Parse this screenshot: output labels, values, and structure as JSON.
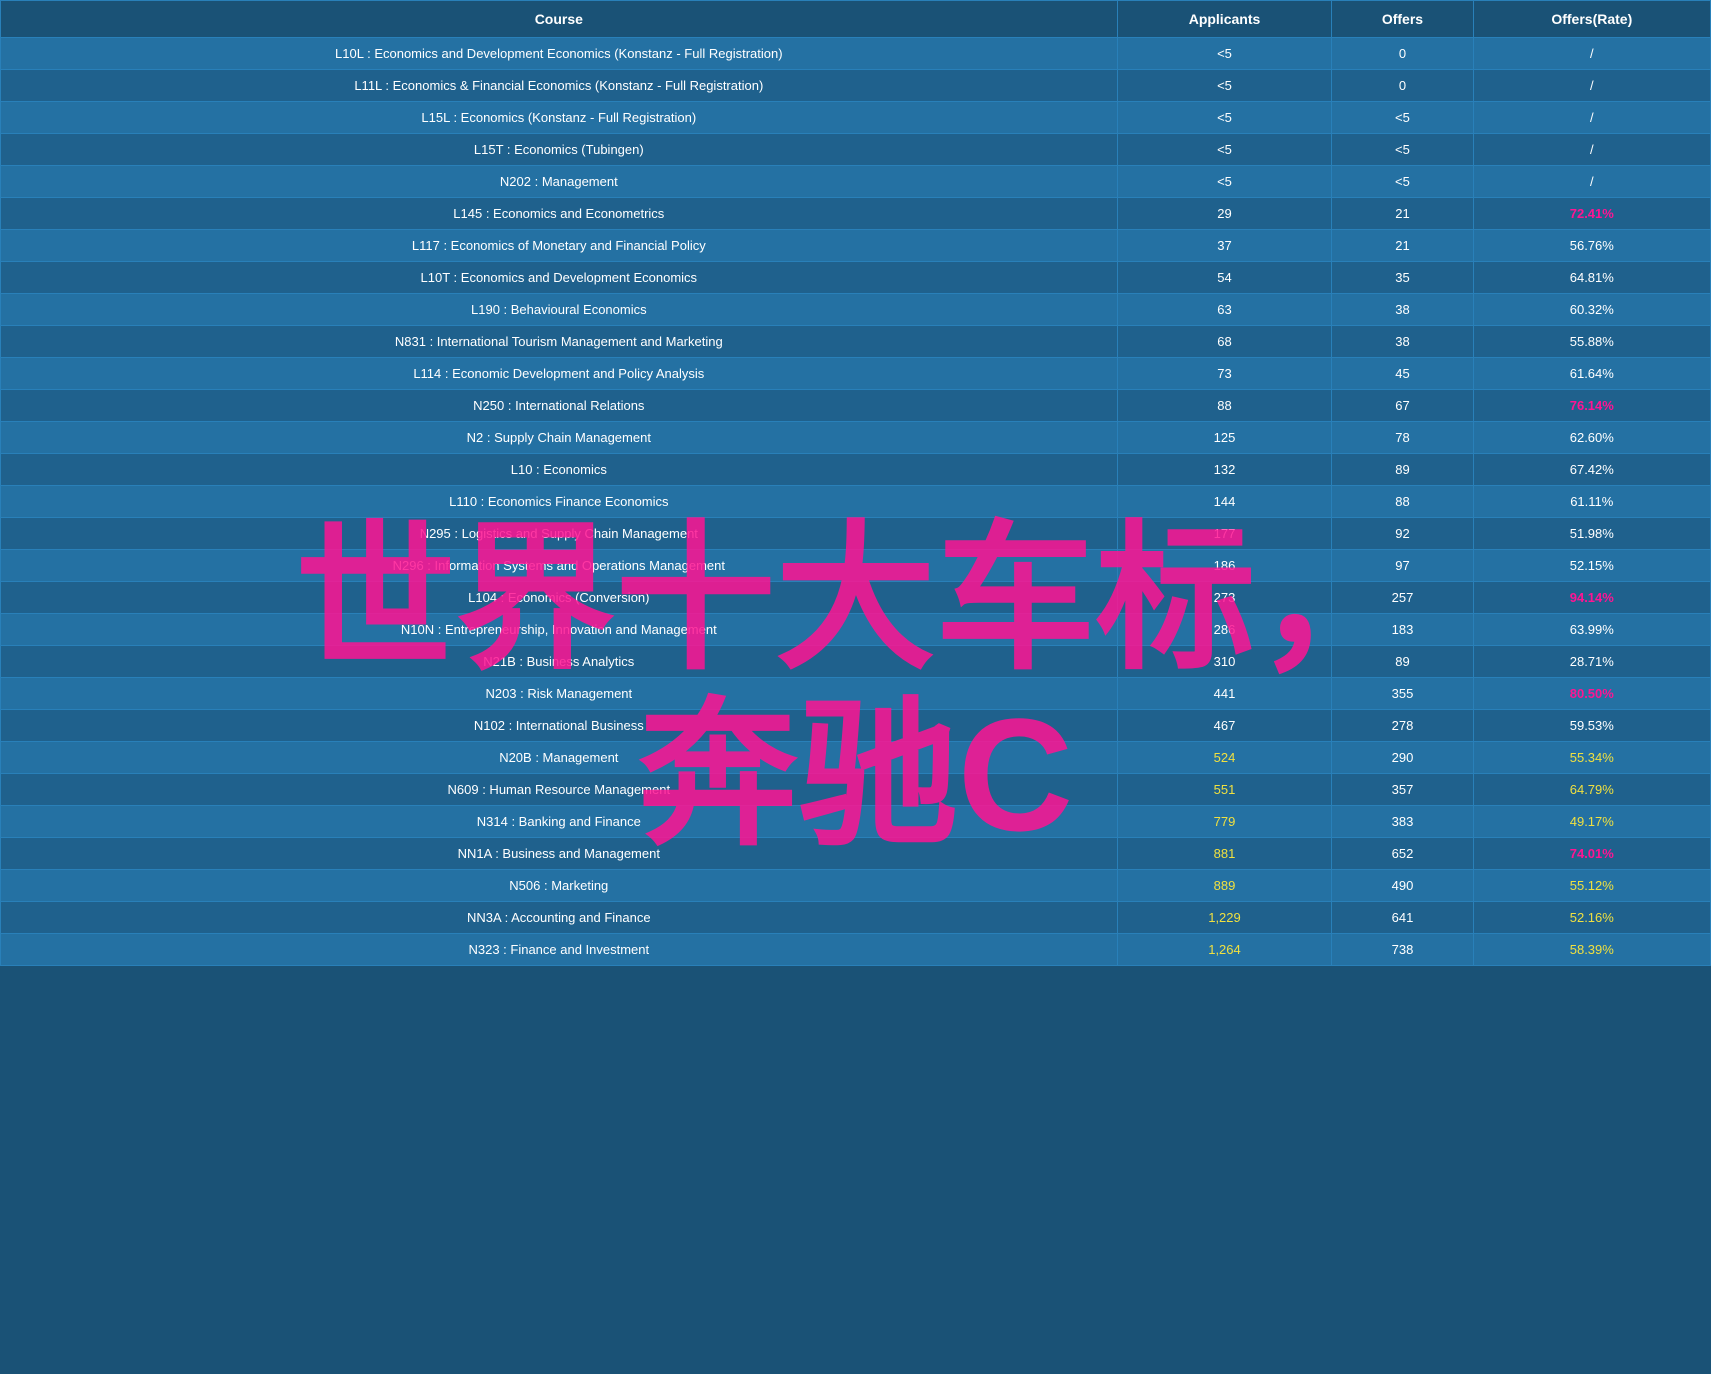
{
  "table": {
    "headers": [
      "Course",
      "Applicants",
      "Offers",
      "Offers(Rate)"
    ],
    "rows": [
      {
        "course": "L10L : Economics and Development Economics (Konstanz - Full Registration)",
        "applicants": "<5",
        "offers": "0",
        "rate": "/",
        "rateClass": ""
      },
      {
        "course": "L11L : Economics & Financial Economics (Konstanz - Full Registration)",
        "applicants": "<5",
        "offers": "0",
        "rate": "/",
        "rateClass": ""
      },
      {
        "course": "L15L : Economics (Konstanz - Full Registration)",
        "applicants": "<5",
        "offers": "<5",
        "rate": "/",
        "rateClass": ""
      },
      {
        "course": "L15T : Economics (Tubingen)",
        "applicants": "<5",
        "offers": "<5",
        "rate": "/",
        "rateClass": ""
      },
      {
        "course": "N202 : Management",
        "applicants": "<5",
        "offers": "<5",
        "rate": "/",
        "rateClass": ""
      },
      {
        "course": "L145 : Economics and Econometrics",
        "applicants": "29",
        "offers": "21",
        "rate": "72.41%",
        "rateClass": "highlight-red"
      },
      {
        "course": "L117 : Economics of Monetary and Financial Policy",
        "applicants": "37",
        "offers": "21",
        "rate": "56.76%",
        "rateClass": ""
      },
      {
        "course": "L10T : Economics and Development Economics",
        "applicants": "54",
        "offers": "35",
        "rate": "64.81%",
        "rateClass": ""
      },
      {
        "course": "L190 : Behavioural Economics",
        "applicants": "63",
        "offers": "38",
        "rate": "60.32%",
        "rateClass": ""
      },
      {
        "course": "N831 : International Tourism Management and Marketing",
        "applicants": "68",
        "offers": "38",
        "rate": "55.88%",
        "rateClass": ""
      },
      {
        "course": "L114 : Economic Development and Policy Analysis",
        "applicants": "73",
        "offers": "45",
        "rate": "61.64%",
        "rateClass": ""
      },
      {
        "course": "N250 : International Relations",
        "applicants": "88",
        "offers": "67",
        "rate": "76.14%",
        "rateClass": "highlight-red"
      },
      {
        "course": "N2 : Supply Chain Management",
        "applicants": "125",
        "offers": "78",
        "rate": "62.60%",
        "rateClass": ""
      },
      {
        "course": "L10 : Economics",
        "applicants": "132",
        "offers": "89",
        "rate": "67.42%",
        "rateClass": ""
      },
      {
        "course": "L110 : Economics Finance Economics",
        "applicants": "144",
        "offers": "88",
        "rate": "61.11%",
        "rateClass": ""
      },
      {
        "course": "N295 : Logistics and Supply Chain Management",
        "applicants": "177",
        "offers": "92",
        "rate": "51.98%",
        "rateClass": ""
      },
      {
        "course": "N296 : Information Systems and Operations Management",
        "applicants": "186",
        "offers": "97",
        "rate": "52.15%",
        "rateClass": ""
      },
      {
        "course": "L104 : Economics (Conversion)",
        "applicants": "273",
        "offers": "257",
        "rate": "94.14%",
        "rateClass": "highlight-red"
      },
      {
        "course": "N10N : Entrepreneurship, Innovation and Management",
        "applicants": "286",
        "offers": "183",
        "rate": "63.99%",
        "rateClass": ""
      },
      {
        "course": "N21B : Business Analytics",
        "applicants": "310",
        "offers": "89",
        "rate": "28.71%",
        "rateClass": ""
      },
      {
        "course": "N203 : Risk Management",
        "applicants": "441",
        "offers": "355",
        "rate": "80.50%",
        "rateClass": "highlight-red"
      },
      {
        "course": "N102 : International Business",
        "applicants": "467",
        "offers": "278",
        "rate": "59.53%",
        "rateClass": ""
      },
      {
        "course": "N20B : Management",
        "applicants": "524",
        "offers": "290",
        "rate": "55.34%",
        "rateClass": "highlight-yellow"
      },
      {
        "course": "N609 : Human Resource Management",
        "applicants": "551",
        "offers": "357",
        "rate": "64.79%",
        "rateClass": "highlight-yellow"
      },
      {
        "course": "N314 : Banking and Finance",
        "applicants": "779",
        "offers": "383",
        "rate": "49.17%",
        "rateClass": "highlight-yellow"
      },
      {
        "course": "NN1A : Business and Management",
        "applicants": "881",
        "offers": "652",
        "rate": "74.01%",
        "rateClass": "highlight-red"
      },
      {
        "course": "N506 : Marketing",
        "applicants": "889",
        "offers": "490",
        "rate": "55.12%",
        "rateClass": "highlight-yellow"
      },
      {
        "course": "NN3A : Accounting and Finance",
        "applicants": "1,229",
        "offers": "641",
        "rate": "52.16%",
        "rateClass": "highlight-yellow"
      },
      {
        "course": "N323 : Finance and Investment",
        "applicants": "1,264",
        "offers": "738",
        "rate": "58.39%",
        "rateClass": "highlight-yellow"
      }
    ]
  },
  "watermark": {
    "line1": "世界十大车标，",
    "line2": "奔驰C"
  }
}
